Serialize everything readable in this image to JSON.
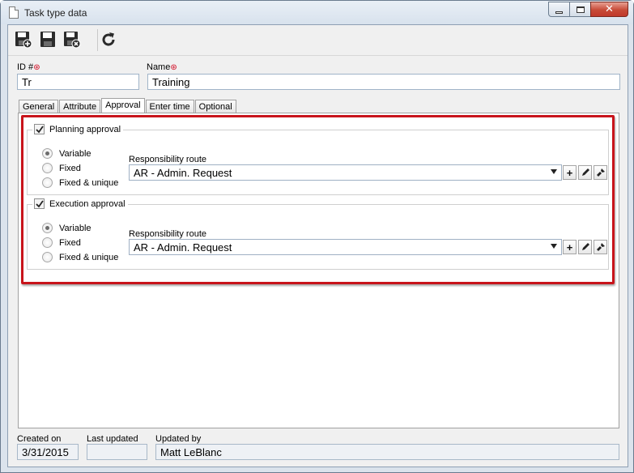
{
  "window": {
    "title": "Task type data"
  },
  "window_controls": {
    "minimize": "minimize-icon",
    "maximize": "maximize-icon",
    "close": "close-icon"
  },
  "toolbar": {
    "buttons": [
      {
        "icon": "save-and-new-icon"
      },
      {
        "icon": "save-icon"
      },
      {
        "icon": "save-and-close-icon"
      },
      {
        "icon": "refresh-icon"
      }
    ]
  },
  "form": {
    "id_label": "ID #",
    "id_value": "Tr",
    "name_label": "Name",
    "name_value": "Training",
    "required_mark": "⊛"
  },
  "tabs": [
    {
      "label": "General",
      "active": false
    },
    {
      "label": "Attribute",
      "active": false
    },
    {
      "label": "Approval",
      "active": true
    },
    {
      "label": "Enter time",
      "active": false
    },
    {
      "label": "Optional",
      "active": false
    }
  ],
  "planning": {
    "title": "Planning approval",
    "checked": true,
    "options": [
      "Variable",
      "Fixed",
      "Fixed & unique"
    ],
    "selected": "Variable",
    "route_label": "Responsibility route",
    "route_value": "AR - Admin. Request"
  },
  "execution": {
    "title": "Execution approval",
    "checked": true,
    "options": [
      "Variable",
      "Fixed",
      "Fixed & unique"
    ],
    "selected": "Variable",
    "route_label": "Responsibility route",
    "route_value": "AR - Admin. Request"
  },
  "route_buttons": {
    "add": "+",
    "edit_icon": "pencil-icon",
    "clear_icon": "brush-icon"
  },
  "footer": {
    "created_label": "Created on",
    "created_value": "3/31/2015",
    "updated_label": "Last updated",
    "updated_value": "",
    "updated_by_label": "Updated by",
    "updated_by_value": "Matt LeBlanc"
  },
  "colors": {
    "highlight": "#c8141b",
    "window_frame": "#dbe3ec",
    "close_button": "#c74a37"
  }
}
